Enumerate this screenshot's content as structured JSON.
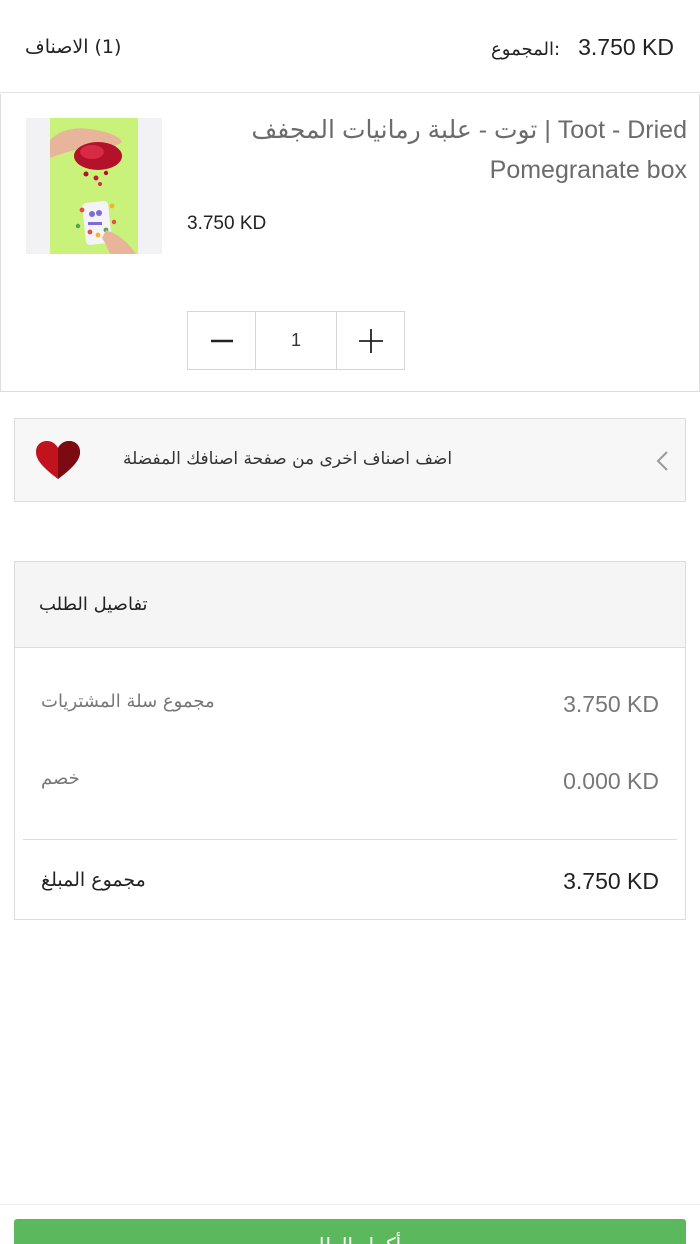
{
  "header": {
    "items_count": "(1) الاصناف",
    "total_label": "المجموع:",
    "total_value": "3.750 KD"
  },
  "cart_item": {
    "name": "توت - علبة رمانيات المجفف  |  Toot - Dried Pomegranate box",
    "price": "3.750 KD",
    "quantity": "1"
  },
  "wishlist_banner": {
    "text": "اضف اصناف اخرى من صفحة اصنافك المفضلة"
  },
  "order_details": {
    "title": "تفاصيل الطلب",
    "subtotal_label": "مجموع سلة المشتريات",
    "subtotal_value": "3.750 KD",
    "discount_label": "خصم",
    "discount_value": "0.000 KD",
    "total_label": "مجموع المبلغ",
    "total_value": "3.750 KD"
  },
  "checkout_button": {
    "label": "أكمل الطلب"
  },
  "icons": {
    "minus": "minus-icon",
    "plus": "plus-icon",
    "chevron": "chevron-left-icon",
    "heart": "heart-icon"
  },
  "colors": {
    "accent_green": "#5cb85c",
    "heart_red": "#c0131d",
    "product_bg_green": "#c9f27a"
  }
}
